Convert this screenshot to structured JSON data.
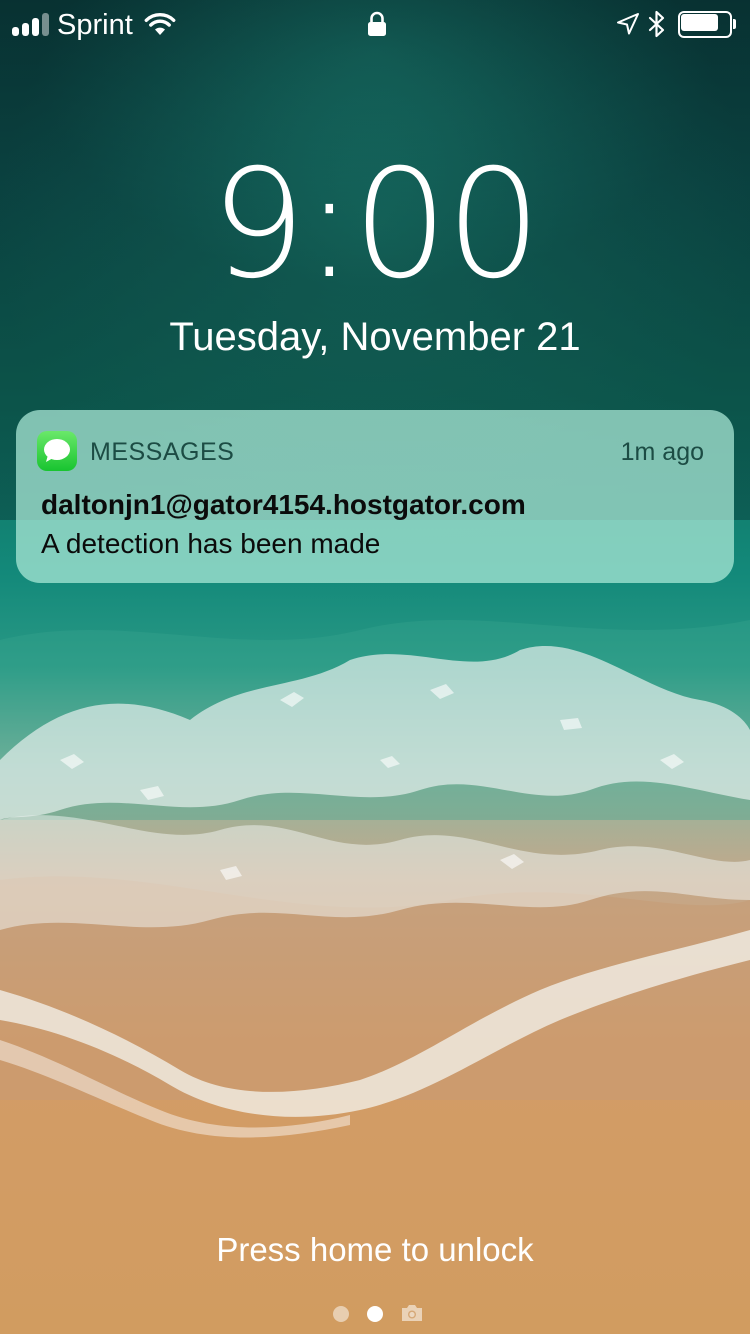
{
  "status_bar": {
    "carrier": "Sprint",
    "signal_bars_filled": 3,
    "signal_bars_total": 4,
    "battery_level_percent": 80,
    "icons": [
      "signal-icon",
      "wifi-icon",
      "lock-icon",
      "location-icon",
      "bluetooth-icon",
      "battery-icon"
    ]
  },
  "lock_screen": {
    "time": "9:00",
    "date": "Tuesday, November 21",
    "unlock_hint": "Press home to unlock",
    "page_dots_total": 2,
    "page_dot_active": 2
  },
  "notification": {
    "app_name": "MESSAGES",
    "app_icon": "messages-icon",
    "time_ago": "1m ago",
    "sender": "daltonjn1@gator4154.hostgator.com",
    "message": "A detection has been made"
  },
  "colors": {
    "notification_bg": "#afebda",
    "messages_icon_green": "#18c430",
    "text_white": "#ffffff"
  }
}
